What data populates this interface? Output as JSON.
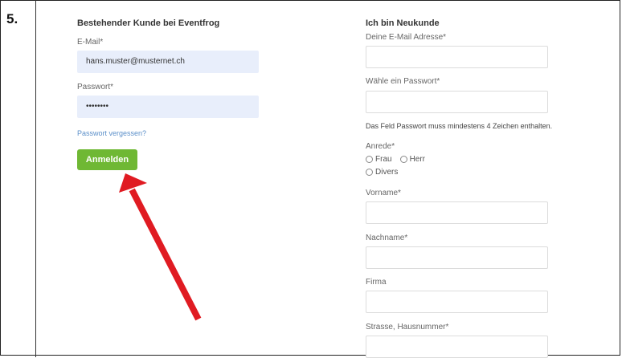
{
  "step_label": "5.",
  "login": {
    "title": "Bestehender Kunde bei Eventfrog",
    "email_label": "E-Mail*",
    "email_value": "hans.muster@musternet.ch",
    "password_label": "Passwort*",
    "password_value": "••••••••",
    "forgot_link": "Passwort vergessen?",
    "submit_label": "Anmelden"
  },
  "register": {
    "title": "Ich bin Neukunde",
    "email_label": "Deine E-Mail Adresse*",
    "password_label": "Wähle ein Passwort*",
    "password_hint": "Das Feld Passwort muss mindestens 4 Zeichen enthalten.",
    "salutation_label": "Anrede*",
    "salutation_options": [
      "Frau",
      "Herr",
      "Divers"
    ],
    "firstname_label": "Vorname*",
    "lastname_label": "Nachname*",
    "company_label": "Firma",
    "street_label": "Strasse, Hausnummer*"
  },
  "colors": {
    "button": "#6fb834",
    "arrow": "#e01b22",
    "link": "#5b8fc9",
    "filled_input": "#e8eefb"
  }
}
